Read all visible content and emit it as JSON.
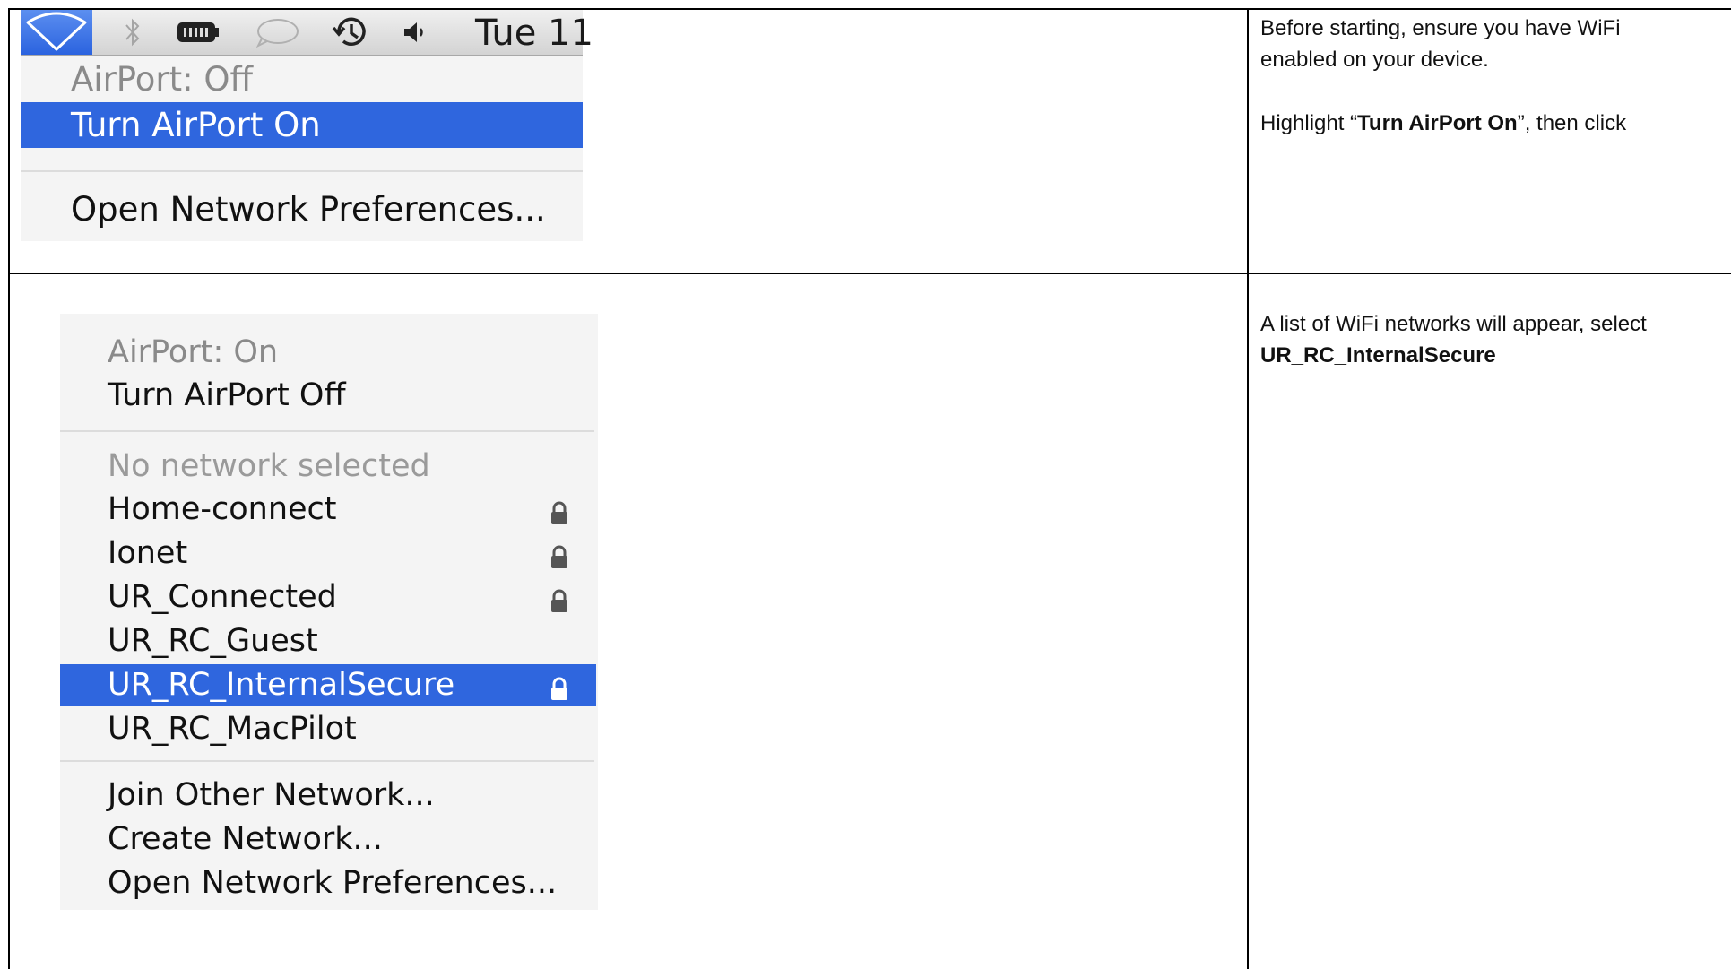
{
  "step1": {
    "menubar": {
      "clock": "Tue 11",
      "icons": [
        "wifi-icon",
        "bluetooth-icon",
        "battery-icon",
        "chat-icon",
        "time-machine-icon",
        "volume-icon"
      ]
    },
    "menu": {
      "status": "AirPort: Off",
      "toggle": "Turn AirPort On",
      "open_prefs": "Open Network Preferences..."
    },
    "instructions": {
      "line1": "Before starting, ensure you have WiFi enabled on your device.",
      "highlight_pre": "Highlight “",
      "highlight_bold": "Turn AirPort On",
      "highlight_post": "”, then click"
    }
  },
  "step2": {
    "menu": {
      "status": "AirPort: On",
      "toggle": "Turn AirPort Off",
      "no_network": "No network selected",
      "networks": [
        {
          "name": "Home-connect",
          "locked": true,
          "selected": false
        },
        {
          "name": "Ionet",
          "locked": true,
          "selected": false
        },
        {
          "name": "UR_Connected",
          "locked": true,
          "selected": false
        },
        {
          "name": "UR_RC_Guest",
          "locked": false,
          "selected": false
        },
        {
          "name": "UR_RC_InternalSecure",
          "locked": true,
          "selected": true
        },
        {
          "name": "UR_RC_MacPilot",
          "locked": false,
          "selected": false
        }
      ],
      "join_other": "Join Other Network...",
      "create": "Create Network...",
      "open_prefs": "Open Network Preferences..."
    },
    "instructions": {
      "line": "A list of WiFi networks will appear, select",
      "bold": "UR_RC_InternalSecure"
    }
  },
  "colors": {
    "highlight": "#2f66de",
    "dim_text": "#8a8a8a",
    "border": "#000000"
  }
}
